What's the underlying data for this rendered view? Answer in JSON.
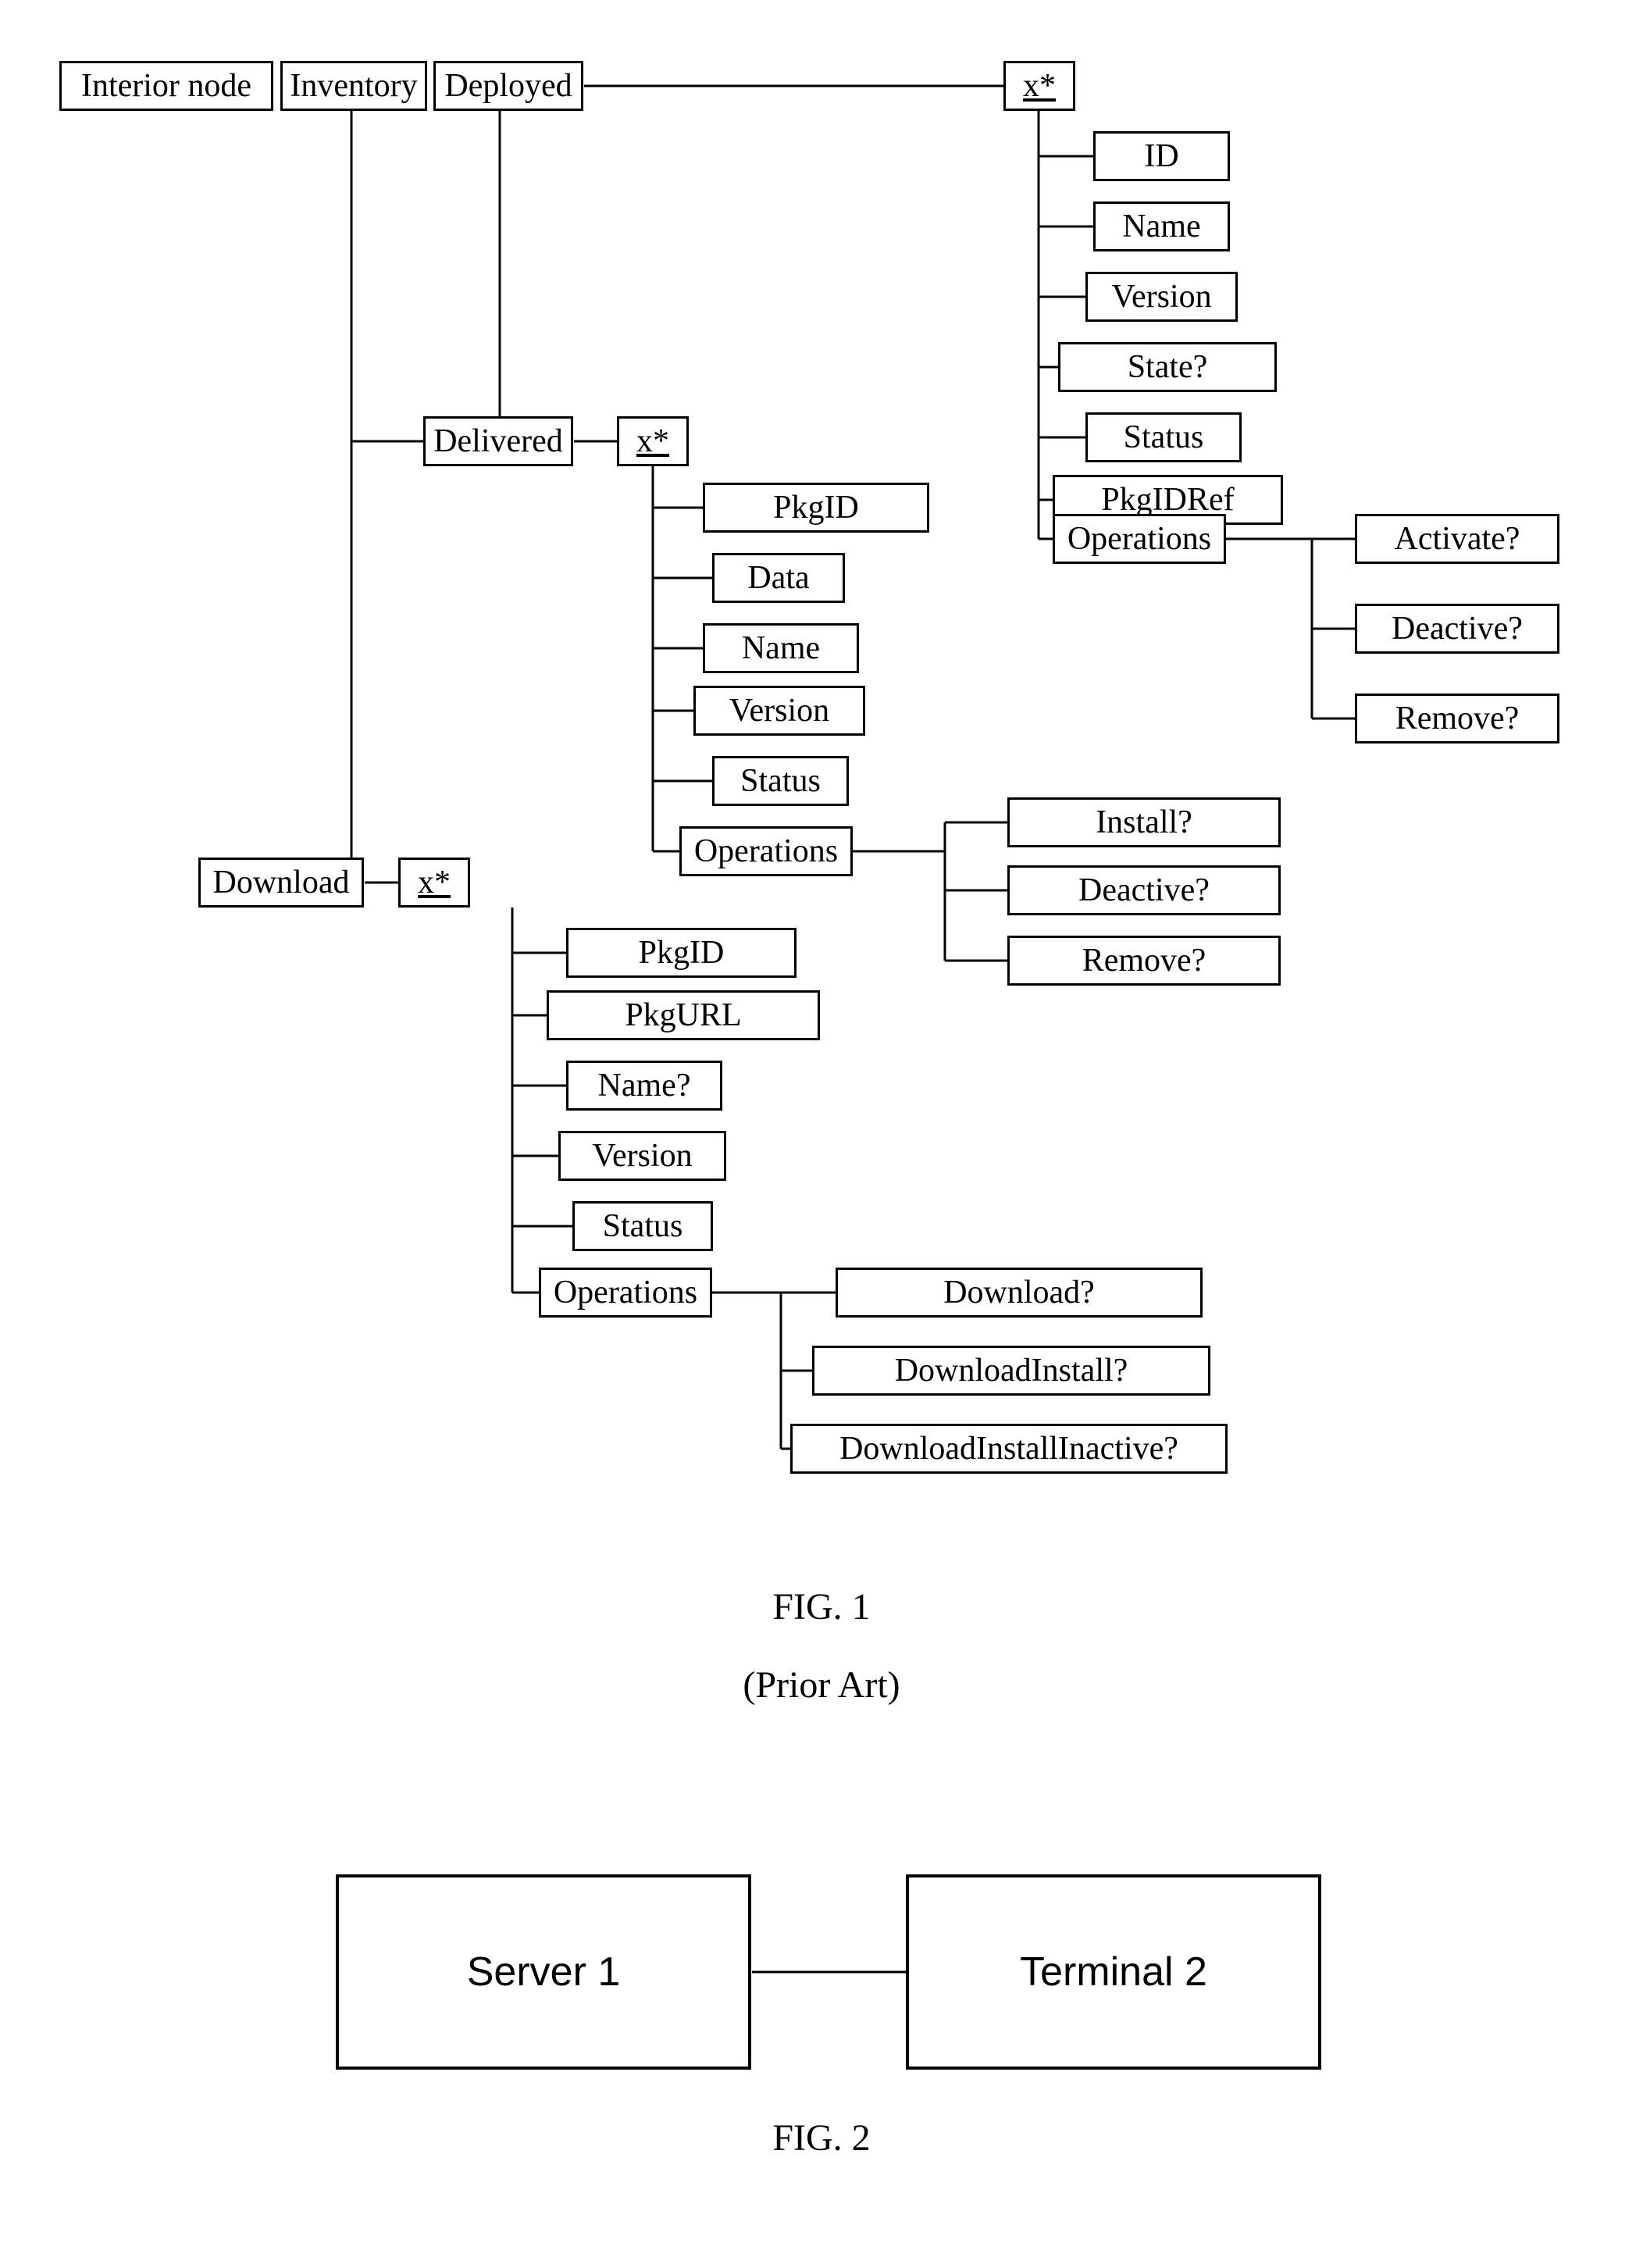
{
  "fig1_caption": "FIG. 1",
  "fig1_sub": "(Prior Art)",
  "fig2_caption": "FIG. 2",
  "server_label": "Server 1",
  "terminal_label": "Terminal 2",
  "tree": {
    "root": "Interior node",
    "inventory": "Inventory",
    "deployed": {
      "label": "Deployed",
      "x": "x*",
      "children": {
        "id": "ID",
        "name": "Name",
        "version": "Version",
        "state": "State?",
        "status": "Status",
        "pkgidref": "PkgIDRef",
        "operations": {
          "label": "Operations",
          "children": {
            "activate": "Activate?",
            "deactive": "Deactive?",
            "remove": "Remove?"
          }
        }
      }
    },
    "delivered": {
      "label": "Delivered",
      "x": "x*",
      "children": {
        "pkgid": "PkgID",
        "data": "Data",
        "name": "Name",
        "version": "Version",
        "status": "Status",
        "operations": {
          "label": "Operations",
          "children": {
            "install": "Install?",
            "deactive": "Deactive?",
            "remove": "Remove?"
          }
        }
      }
    },
    "download": {
      "label": "Download",
      "x": "x*",
      "children": {
        "pkgid": "PkgID",
        "pkgurl": "PkgURL",
        "name": "Name?",
        "version": "Version",
        "status": "Status",
        "operations": {
          "label": "Operations",
          "children": {
            "download": "Download?",
            "downloadinstall": "DownloadInstall?",
            "downloadinstallinactive": "DownloadInstallInactive?"
          }
        }
      }
    }
  }
}
